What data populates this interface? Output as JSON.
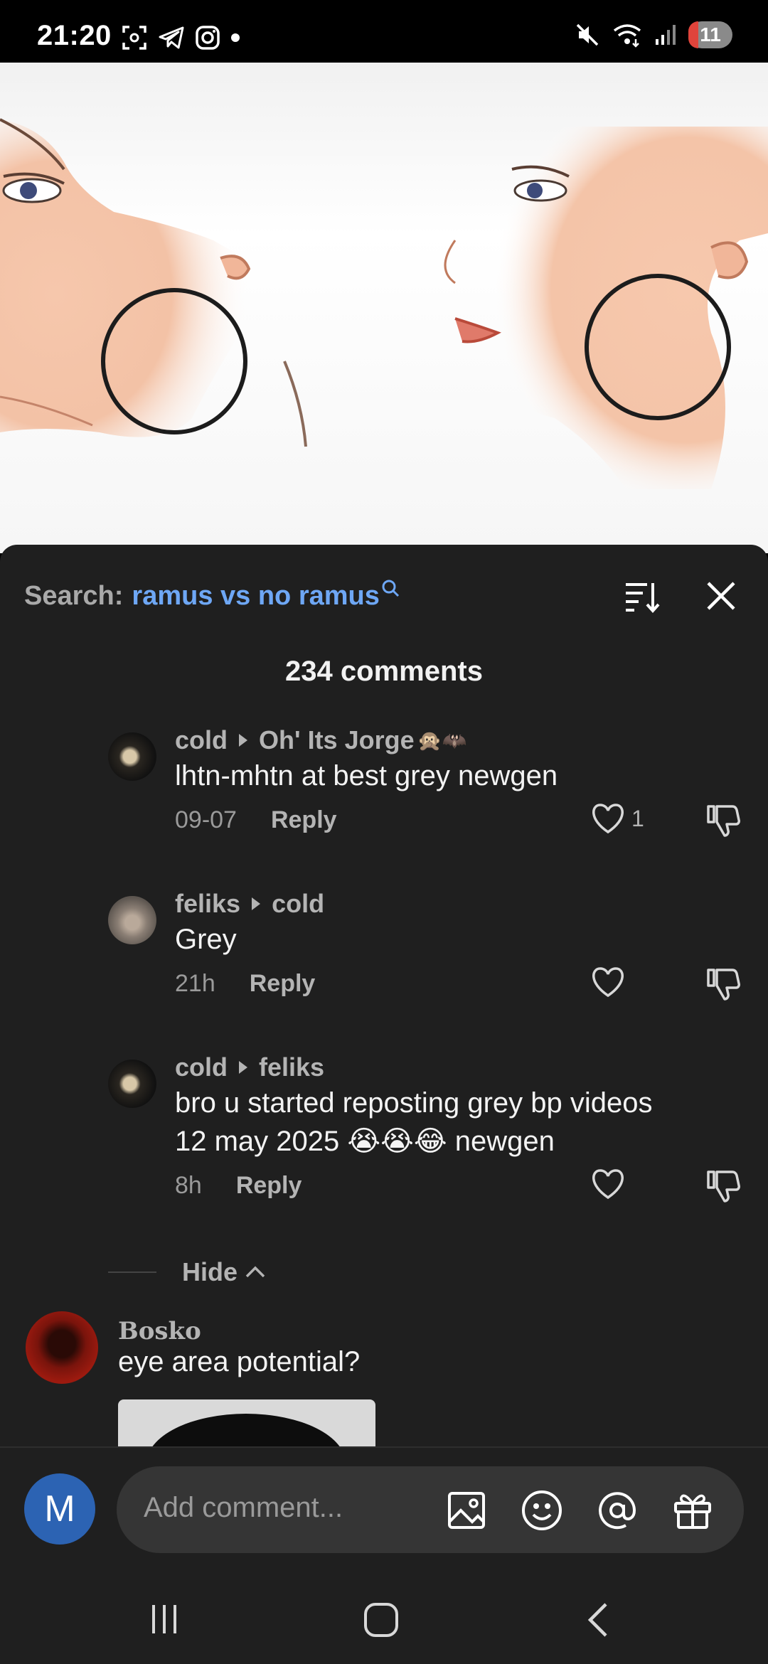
{
  "status_bar": {
    "time": "21:20",
    "battery": "11",
    "left_icons": [
      "screenshot-icon",
      "telegram-icon",
      "instagram-icon",
      "dot-icon"
    ],
    "right_icons": [
      "mute-icon",
      "wifi-icon",
      "signal-icon",
      "battery-icon"
    ]
  },
  "comments_panel": {
    "search_label": "Search:",
    "search_term": "ramus vs no ramus",
    "count_label": "234 comments",
    "comments": [
      {
        "author": "cold",
        "reply_to": "Oh' Its Jorge",
        "reply_to_emoji": "🙊🦇",
        "text": "lhtn-mhtn at best grey newgen",
        "time": "09-07",
        "reply_label": "Reply",
        "likes": "1"
      },
      {
        "author": "feliks",
        "reply_to": "cold",
        "text": "Grey",
        "time": "21h",
        "reply_label": "Reply",
        "likes": ""
      },
      {
        "author": "cold",
        "reply_to": "feliks",
        "text_line1": "bro u started reposting grey bp videos",
        "text_line2": "12 may 2025 😭😭😂 newgen",
        "time": "8h",
        "reply_label": "Reply",
        "likes": ""
      }
    ],
    "hide_label": "Hide",
    "top_comment": {
      "author": "Bosko",
      "text": "eye area potential?"
    }
  },
  "input_bar": {
    "avatar_letter": "M",
    "placeholder": "Add comment..."
  },
  "colors": {
    "sheet_bg": "#1f1f1f",
    "accent_blue": "#6ea7f5",
    "avatar_blue": "#2c63b3"
  }
}
